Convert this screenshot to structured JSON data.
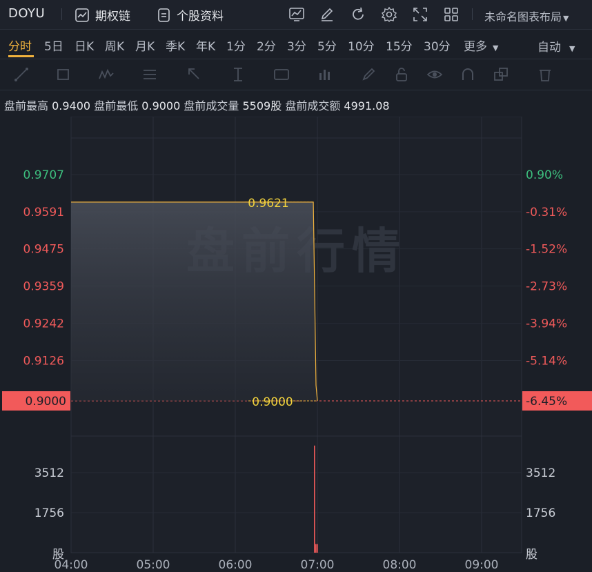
{
  "topbar": {
    "symbol": "DOYU",
    "option_chain": "期权链",
    "stock_profile": "个股资料",
    "layout_name": "未命名图表布局",
    "icons": [
      "chart-icon",
      "pencil-icon",
      "refresh-icon",
      "settings-icon",
      "fullscreen-icon",
      "grid-layout-icon"
    ]
  },
  "periods": {
    "items": [
      "分时",
      "5日",
      "日K",
      "周K",
      "月K",
      "季K",
      "年K",
      "1分",
      "2分",
      "3分",
      "5分",
      "10分",
      "15分",
      "30分",
      "更多"
    ],
    "active": "分时",
    "auto": "自动"
  },
  "drawing_tools": [
    "line-tool-icon",
    "rectangle-tool-icon",
    "pattern-tool-icon",
    "fib-tool-icon",
    "arrow-tool-icon",
    "measure-tool-icon",
    "text-tool-icon",
    "indicator-tool-icon",
    "brush-icon",
    "lock-icon",
    "eye-icon",
    "magnet-icon",
    "layers-icon",
    "trash-icon"
  ],
  "info": {
    "high_label": "盘前最高",
    "high": "0.9400",
    "low_label": "盘前最低",
    "low": "0.9000",
    "volume_label": "盘前成交量",
    "volume": "5509股",
    "amount_label": "盘前成交额",
    "amount": "4991.08"
  },
  "colors": {
    "up": "#3dbf7e",
    "down": "#f05a5a",
    "price_line": "#f2b33d",
    "highlight": "#f25a5a"
  },
  "chart_data": {
    "type": "line",
    "watermark": "盘前行情",
    "x_ticks": [
      "04:00",
      "05:00",
      "06:00",
      "07:00",
      "08:00",
      "09:00"
    ],
    "price_ticks": [
      "0.9707",
      "0.9591",
      "0.9475",
      "0.9359",
      "0.9242",
      "0.9126",
      "0.9000"
    ],
    "pct_ticks": [
      "0.90%",
      "-0.31%",
      "-1.52%",
      "-2.73%",
      "-3.94%",
      "-5.14%",
      "-6.45%"
    ],
    "ylim": [
      0.9,
      0.9707
    ],
    "price_series": [
      {
        "t": "04:00",
        "v": 0.9621
      },
      {
        "t": "06:57",
        "v": 0.9621
      },
      {
        "t": "06:59",
        "v": 0.9049
      },
      {
        "t": "07:00",
        "v": 0.9
      }
    ],
    "price_labels": [
      "0.9621",
      "0.9000"
    ],
    "current_price": "0.9000",
    "current_pct": "-6.45%",
    "volume_ticks": [
      "3512",
      "1756",
      "股"
    ],
    "volume_series": [
      {
        "t": "06:58",
        "v": 4700
      },
      {
        "t": "06:59",
        "v": 380
      },
      {
        "t": "07:00",
        "v": 380
      }
    ]
  }
}
